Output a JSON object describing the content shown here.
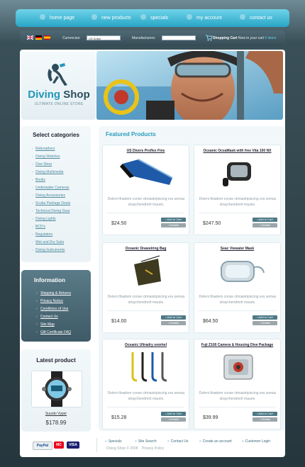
{
  "nav": {
    "items": [
      {
        "label": "home page"
      },
      {
        "label": "new products"
      },
      {
        "label": "specials"
      },
      {
        "label": "my account"
      },
      {
        "label": "contact us"
      }
    ]
  },
  "toolbar": {
    "currencies_label": "Currencies:",
    "currency_value": "US Dollar",
    "manufacturers_label": "Manufacturers:",
    "cart_label": "Shopping Cart",
    "cart_text_prefix": "Now in your cart",
    "cart_count": "0 items"
  },
  "logo": {
    "title_a": "Diving",
    "title_b": "Shop",
    "subtitle": "ULTIMATE ONLINE STORE"
  },
  "categories": {
    "title": "Select categories",
    "items": [
      "Rebreathers",
      "Diving Watches",
      "Dive Wear",
      "Diving Multimedia",
      "Books",
      "Underwater Cameras",
      "Diving Accessories",
      "Scuba Package Deals",
      "Technical Diving Gear",
      "Diving Lights",
      "BCD's",
      "Regulators",
      "Wet and Dry Suits",
      "Diving Instruments"
    ]
  },
  "information": {
    "title": "Information",
    "items": [
      "Shipping & Returns",
      "Privacy Notice",
      "Conditions of Use",
      "Contact Us",
      "Site Map",
      "Gift Certificate FAQ"
    ]
  },
  "latest": {
    "title": "Latest product",
    "name": "Suunto Vyper",
    "price": "$178.99"
  },
  "featured": {
    "title": "Featured Products",
    "add_label": "Add to Cart",
    "details_label": "Details",
    "products": [
      {
        "name": "US Divers Proflex Fins",
        "desc": "Deleni tfoadem conse ctmiastripiscing era semas straychendrerit mauris.",
        "price": "$24.50"
      },
      {
        "name": "Oceanic OceaMask with free Vita 100 NX",
        "desc": "Deleni tfoadem conse ctmiastripiscing era semas straychendrerit mauris.",
        "price": "$247.50"
      },
      {
        "name": "Oceanic Drawstring Bag",
        "desc": "Deleni tfoadem conse ctmiastripiscing era semas straychendrerit mauris.",
        "price": "$14.00"
      },
      {
        "name": "Seac Viewater Mask",
        "desc": "Deleni tfoadem conse ctmiastripiscing era semas straychendrerit mauris.",
        "price": "$64.50"
      },
      {
        "name": "Oceanic Ultradry snorkel",
        "desc": "Deleni tfoadem conse ctmiastripiscing era semas straychendrerit mauris.",
        "price": "$15.28"
      },
      {
        "name": "Fuji Z100 Camera & Housing Dive Package",
        "desc": "Deleni tfoadem conse ctmiastripiscing era semas straychendrerit mauris.",
        "price": "$39.99"
      }
    ]
  },
  "footer": {
    "payments": [
      "PayPal",
      "MC",
      "VISA"
    ],
    "links": [
      "Specials",
      "Site Search",
      "Contact Us",
      "Create an account",
      "Customer Login"
    ],
    "copyright": "Diving Shop © 2008",
    "privacy": "Privacy Policy"
  },
  "colors": {
    "accent": "#2197b8",
    "nav_gradient_top": "#6fd3e9",
    "nav_gradient_bottom": "#28a6c7",
    "info_box": "#4e6e7b"
  }
}
